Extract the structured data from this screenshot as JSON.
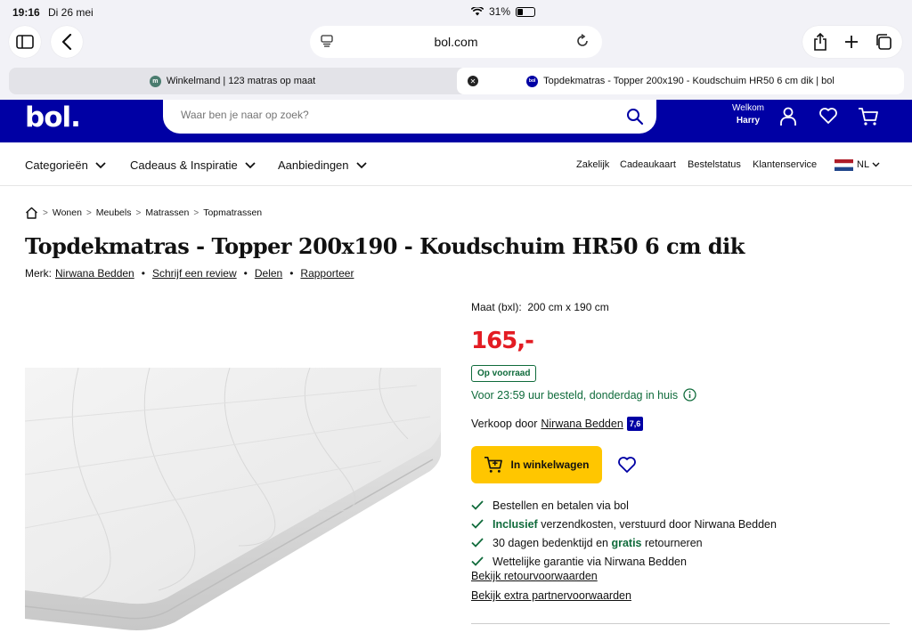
{
  "status": {
    "time": "19:16",
    "date": "Di 26 mei",
    "battery": "31%"
  },
  "browser": {
    "domain": "bol.com",
    "tabs": [
      {
        "title": "Winkelmand | 123 matras op maat",
        "favicon": "m",
        "favicon_color": "#4a7c6f"
      },
      {
        "title": "Topdekmatras - Topper 200x190 - Koudschuim HR50 6 cm dik | bol",
        "favicon": "bol",
        "favicon_color": "#0000a4"
      }
    ]
  },
  "header": {
    "logo": "bol.",
    "search_placeholder": "Waar ben je naar op zoek?",
    "welcome": "Welkom",
    "user": "Harry",
    "brand_color": "#0000a4"
  },
  "nav": {
    "categories": "Categorieën",
    "gifts": "Cadeaus & Inspiratie",
    "offers": "Aanbiedingen",
    "business": "Zakelijk",
    "giftcard": "Cadeaukaart",
    "orderstatus": "Bestelstatus",
    "service": "Klantenservice",
    "language": "NL"
  },
  "breadcrumb": [
    "Wonen",
    "Meubels",
    "Matrassen",
    "Topmatrassen"
  ],
  "product": {
    "title": "Topdekmatras - Topper 200x190 - Koudschuim HR50 6 cm dik",
    "brand_label": "Merk:",
    "brand": "Nirwana Bedden",
    "review": "Schrijf een review",
    "share": "Delen",
    "report": "Rapporteer",
    "size_label": "Maat (bxl):",
    "size_value": "200 cm x 190 cm",
    "price": "165,-",
    "stock": "Op voorraad",
    "delivery": "Voor 23:59 uur besteld, donderdag in huis",
    "seller_label": "Verkoop door",
    "seller": "Nirwana Bedden",
    "seller_score": "7,6",
    "cart_button": "In winkelwagen",
    "usps": [
      {
        "pre": "",
        "hl": "",
        "text": "Bestellen en betalen via bol"
      },
      {
        "pre": "",
        "hl": "Inclusief",
        "text": " verzendkosten, verstuurd door Nirwana Bedden"
      },
      {
        "pre": "30 dagen bedenktijd en ",
        "hl": "gratis",
        "text": " retourneren"
      },
      {
        "pre": "",
        "hl": "",
        "text": "Wettelijke garantie via Nirwana Bedden"
      }
    ],
    "link_returns": "Bekijk retourvoorwaarden",
    "link_partner": "Bekijk extra partnervoorwaarden",
    "price_color": "#e31c23",
    "green": "#0f6b3b"
  }
}
